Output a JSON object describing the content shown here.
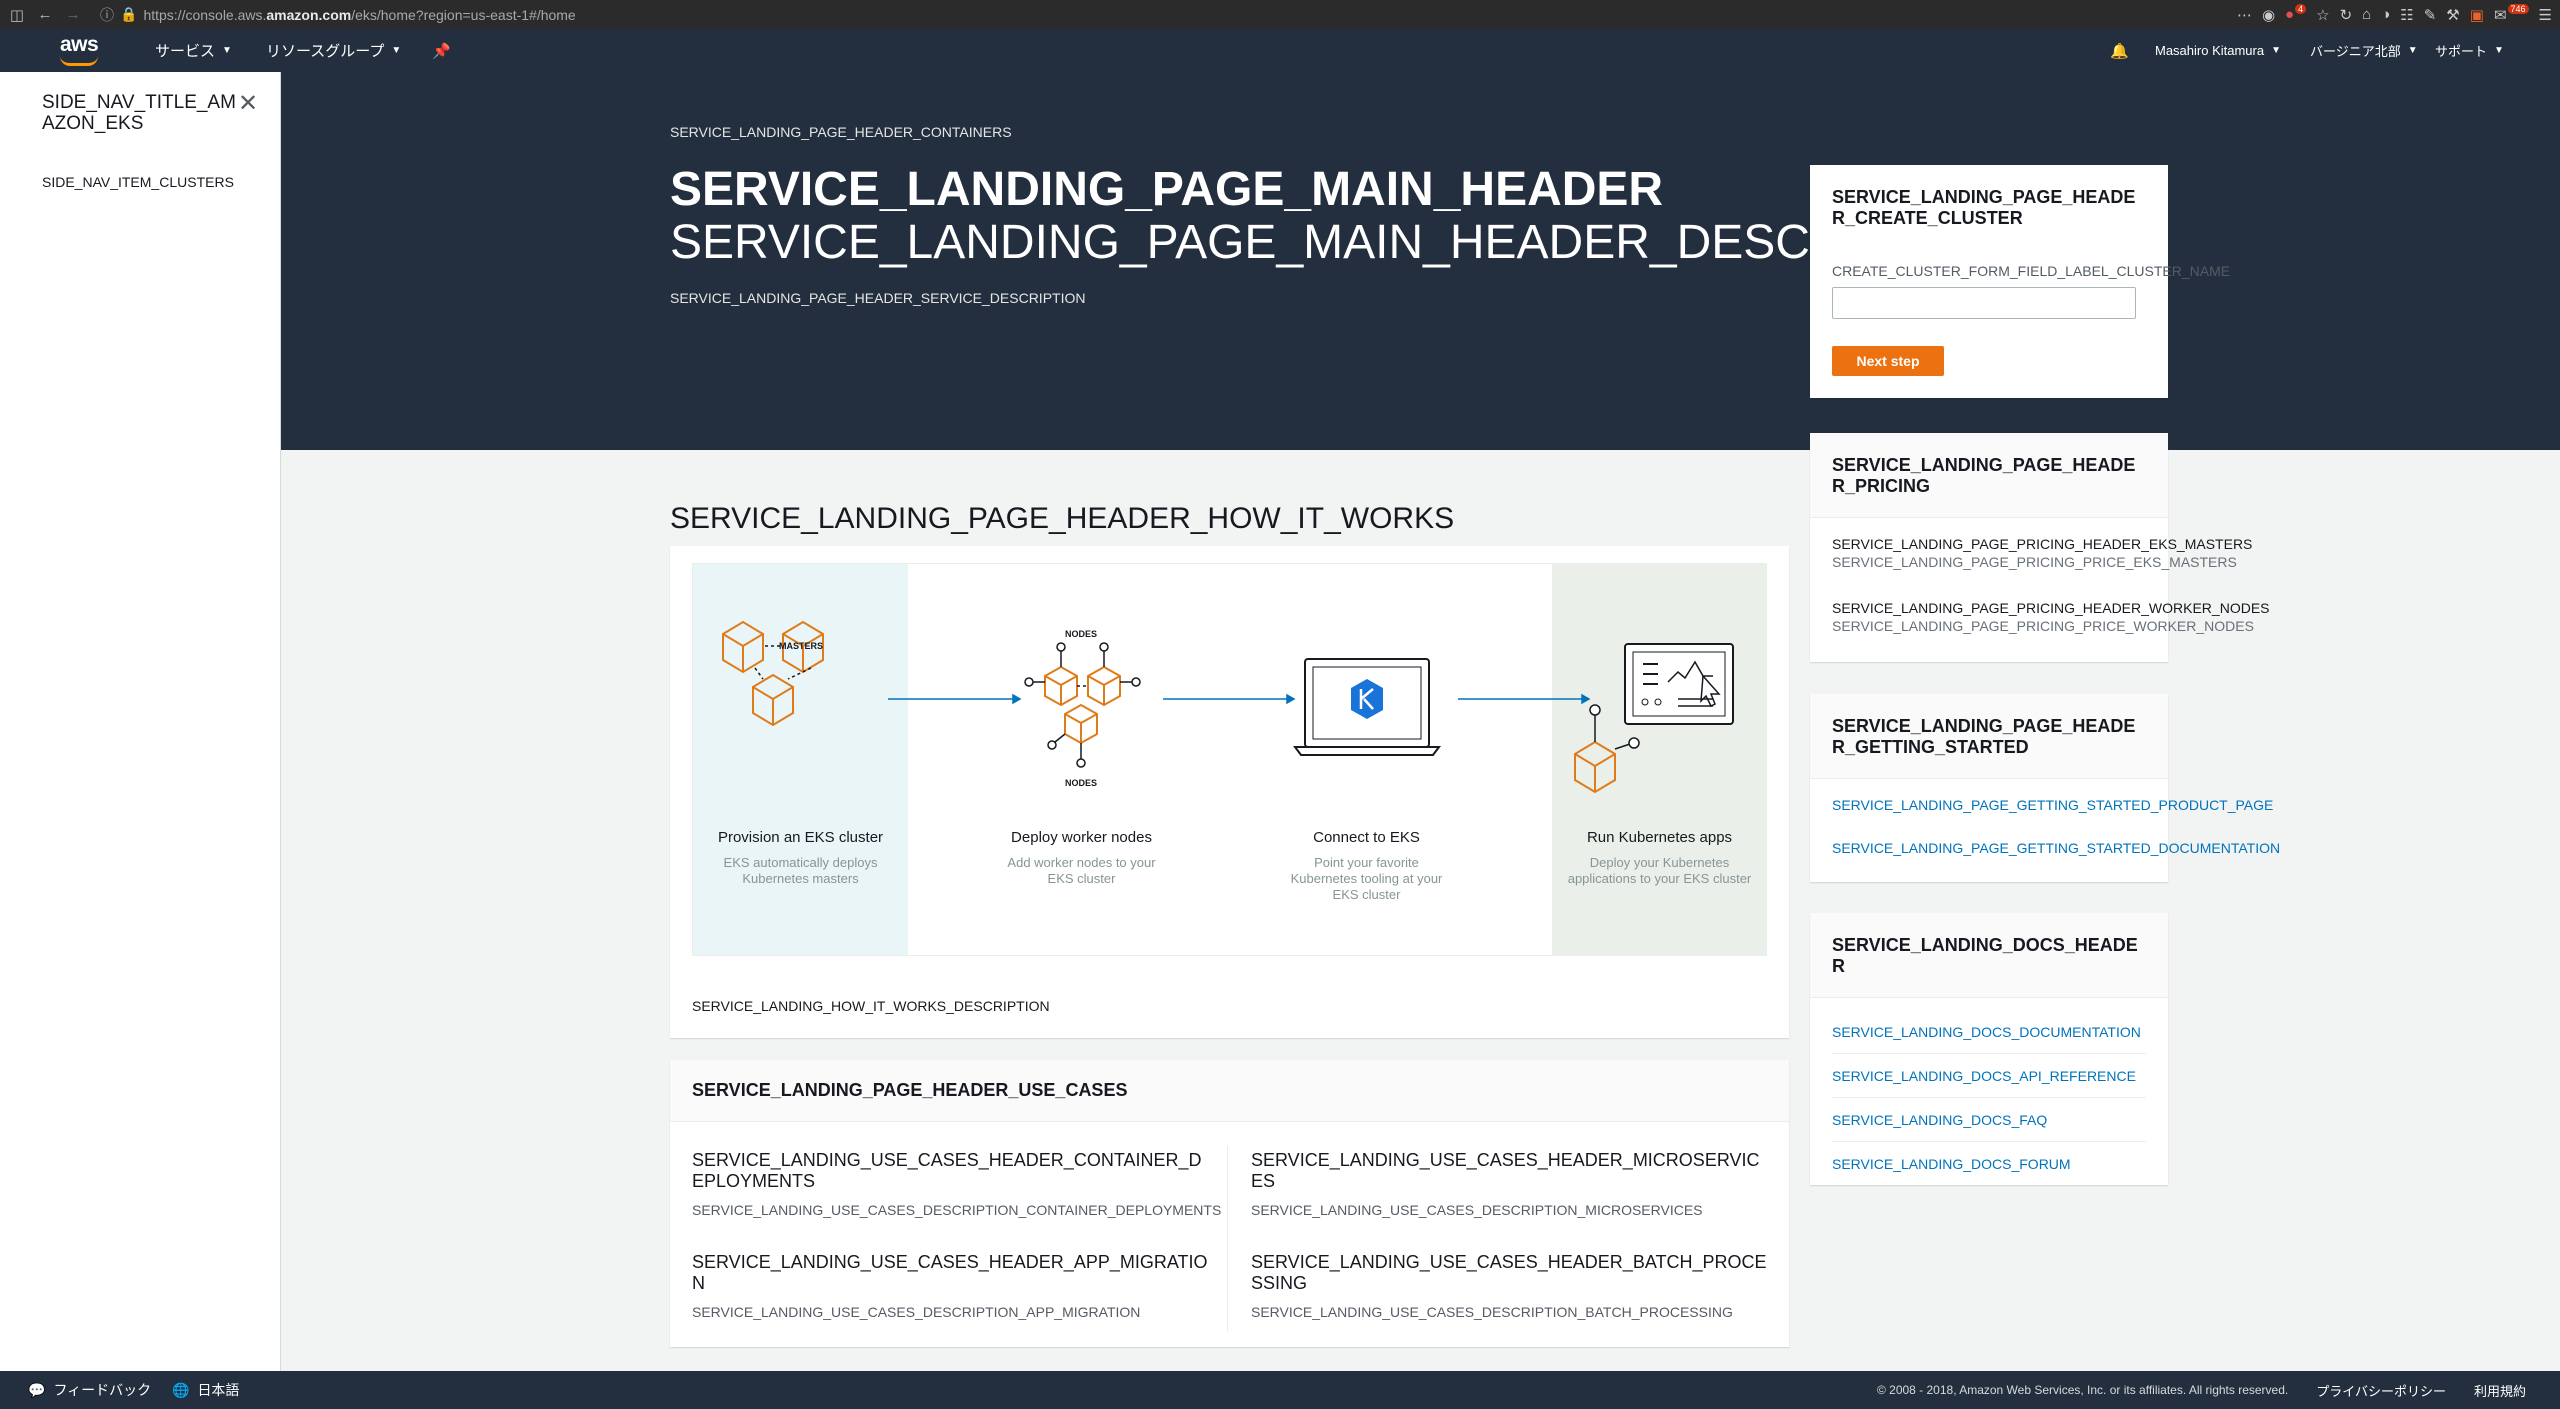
{
  "browser": {
    "url_prefix": "https://console.aws.",
    "url_domain": "amazon.com",
    "url_suffix": "/eks/home?region=us-east-1#/home",
    "badge_count": "746",
    "badge_small": "4"
  },
  "topnav": {
    "logo": "aws",
    "services": "サービス",
    "resource_groups": "リソースグループ",
    "user": "Masahiro Kitamura",
    "region": "バージニア北部",
    "support": "サポート"
  },
  "sidenav": {
    "title": "SIDE_NAV_TITLE_AMAZON_EKS",
    "items": [
      "SIDE_NAV_ITEM_CLUSTERS"
    ]
  },
  "hero": {
    "eyebrow": "SERVICE_LANDING_PAGE_HEADER_CONTAINERS",
    "title": "SERVICE_LANDING_PAGE_MAIN_HEADER",
    "subtitle": "SERVICE_LANDING_PAGE_MAIN_HEADER_DESCRIPTION",
    "description": "SERVICE_LANDING_PAGE_HEADER_SERVICE_DESCRIPTION"
  },
  "create_cluster": {
    "header": "SERVICE_LANDING_PAGE_HEADER_CREATE_CLUSTER",
    "field_label": "CREATE_CLUSTER_FORM_FIELD_LABEL_CLUSTER_NAME",
    "field_value": "",
    "button": "Next step"
  },
  "pricing": {
    "header": "SERVICE_LANDING_PAGE_HEADER_PRICING",
    "rows": [
      {
        "header": "SERVICE_LANDING_PAGE_PRICING_HEADER_EKS_MASTERS",
        "price": "SERVICE_LANDING_PAGE_PRICING_PRICE_EKS_MASTERS"
      },
      {
        "header": "SERVICE_LANDING_PAGE_PRICING_HEADER_WORKER_NODES",
        "price": "SERVICE_LANDING_PAGE_PRICING_PRICE_WORKER_NODES"
      }
    ]
  },
  "getting_started": {
    "header": "SERVICE_LANDING_PAGE_HEADER_GETTING_STARTED",
    "links": [
      "SERVICE_LANDING_PAGE_GETTING_STARTED_PRODUCT_PAGE",
      "SERVICE_LANDING_PAGE_GETTING_STARTED_DOCUMENTATION"
    ]
  },
  "docs": {
    "header": "SERVICE_LANDING_DOCS_HEADER",
    "links": [
      "SERVICE_LANDING_DOCS_DOCUMENTATION",
      "SERVICE_LANDING_DOCS_API_REFERENCE",
      "SERVICE_LANDING_DOCS_FAQ",
      "SERVICE_LANDING_DOCS_FORUM"
    ]
  },
  "how_it_works": {
    "header": "SERVICE_LANDING_PAGE_HEADER_HOW_IT_WORKS",
    "description": "SERVICE_LANDING_HOW_IT_WORKS_DESCRIPTION",
    "diagram_labels": {
      "masters": "MASTERS",
      "nodes_top": "NODES",
      "nodes_bottom": "NODES"
    },
    "steps": [
      {
        "title": "Provision an EKS cluster",
        "desc": "EKS automatically deploys Kubernetes masters"
      },
      {
        "title": "Deploy worker nodes",
        "desc": "Add worker nodes to your EKS cluster"
      },
      {
        "title": "Connect to EKS",
        "desc": "Point your favorite Kubernetes tooling at your EKS cluster"
      },
      {
        "title": "Run Kubernetes apps",
        "desc": "Deploy your Kubernetes applications to your EKS cluster"
      }
    ]
  },
  "use_cases": {
    "header": "SERVICE_LANDING_PAGE_HEADER_USE_CASES",
    "items": [
      {
        "header": "SERVICE_LANDING_USE_CASES_HEADER_CONTAINER_DEPLOYMENTS",
        "desc": "SERVICE_LANDING_USE_CASES_DESCRIPTION_CONTAINER_DEPLOYMENTS"
      },
      {
        "header": "SERVICE_LANDING_USE_CASES_HEADER_MICROSERVICES",
        "desc": "SERVICE_LANDING_USE_CASES_DESCRIPTION_MICROSERVICES"
      },
      {
        "header": "SERVICE_LANDING_USE_CASES_HEADER_APP_MIGRATION",
        "desc": "SERVICE_LANDING_USE_CASES_DESCRIPTION_APP_MIGRATION"
      },
      {
        "header": "SERVICE_LANDING_USE_CASES_HEADER_BATCH_PROCESSING",
        "desc": "SERVICE_LANDING_USE_CASES_DESCRIPTION_BATCH_PROCESSING"
      }
    ]
  },
  "footer": {
    "feedback": "フィードバック",
    "language": "日本語",
    "copyright": "© 2008 - 2018, Amazon Web Services, Inc. or its affiliates. All rights reserved.",
    "privacy": "プライバシーポリシー",
    "terms": "利用規約"
  },
  "colors": {
    "nav_bg": "#232f3e",
    "accent_orange": "#ec7211",
    "link_blue": "#0073bb",
    "diagram_orange": "#e07b1a",
    "page_bg": "#f2f3f3"
  }
}
